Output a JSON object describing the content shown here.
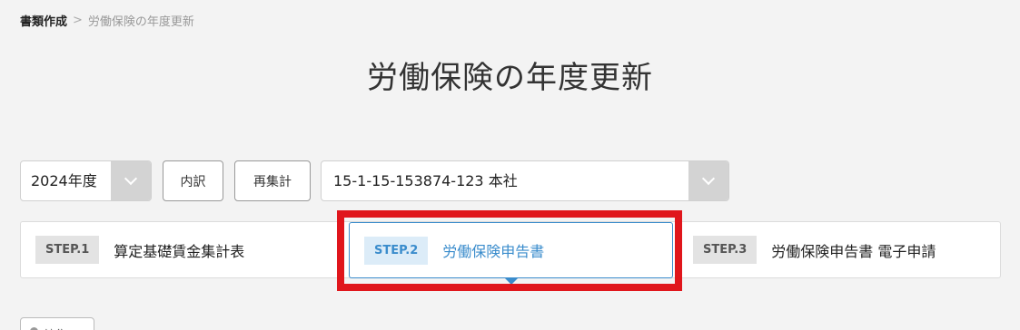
{
  "breadcrumb": {
    "parent": "書類作成",
    "separator": ">",
    "current": "労働保険の年度更新"
  },
  "page": {
    "title": "労働保険の年度更新"
  },
  "toolbar": {
    "year_select": {
      "value": "2024年度"
    },
    "breakdown_button": "内訳",
    "recalc_button": "再集計",
    "office_select": {
      "value": "15-1-15-153874-123 本社"
    }
  },
  "steps": [
    {
      "badge": "STEP.1",
      "label": "算定基礎賃金集計表",
      "active": false
    },
    {
      "badge": "STEP.2",
      "label": "労働保険申告書",
      "active": true
    },
    {
      "badge": "STEP.3",
      "label": "労働保険申告書 電子申請",
      "active": false
    }
  ],
  "bottom": {
    "partial_button_label": "編集"
  },
  "colors": {
    "accent": "#3a8ccc",
    "highlight": "#e0161c",
    "background": "#f3f3f3"
  }
}
